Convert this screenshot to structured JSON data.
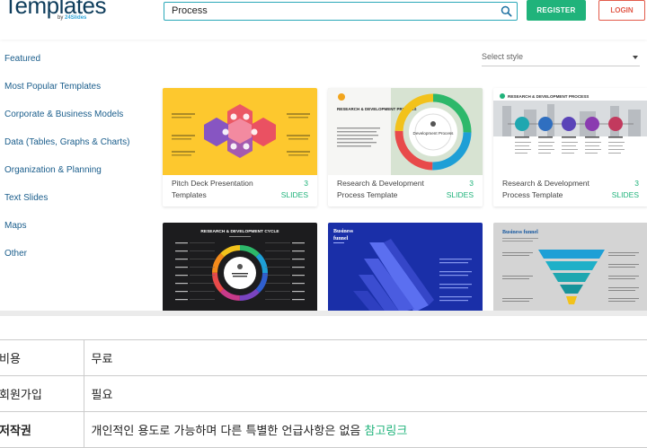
{
  "header": {
    "logo_text": "Templates",
    "logo_by": "by",
    "logo_brand": "24Slides",
    "search_value": "Process",
    "register_label": "REGISTER",
    "login_label": "LOGIN"
  },
  "sidebar": {
    "items": [
      {
        "label": "Featured"
      },
      {
        "label": "Most Popular Templates"
      },
      {
        "label": "Corporate & Business Models"
      },
      {
        "label": "Data (Tables, Graphs & Charts)"
      },
      {
        "label": "Organization & Planning"
      },
      {
        "label": "Text Slides"
      },
      {
        "label": "Maps"
      },
      {
        "label": "Other"
      }
    ]
  },
  "filter": {
    "select_style_placeholder": "Select style"
  },
  "cards": [
    {
      "title": "Pitch Deck Presentation Templates",
      "count": "3",
      "count_unit": "SLIDES"
    },
    {
      "title": "Research & Development Process Template",
      "count": "3",
      "count_unit": "SLIDES"
    },
    {
      "title": "Research & Development Process Template",
      "count": "3",
      "count_unit": "SLIDES"
    }
  ],
  "thumb_text": {
    "rd_process": "RESEARCH & DEVELOPMENT PROCESS",
    "dev_process": "Development Process",
    "rd_cycle": "RESEARCH & DEVELOPMENT CYCLE",
    "business_funnel": "Business funnel",
    "business": "Business",
    "funnel": "funnel"
  },
  "info_table": {
    "rows": [
      {
        "key": "비용",
        "value": "무료"
      },
      {
        "key": "회원가입",
        "value": "필요"
      },
      {
        "key": "저작권",
        "value": "개인적인 용도로 가능하며 다른 특별한 언급사항은 없음 ",
        "link": "참고링크"
      }
    ]
  },
  "colors": {
    "accent_green": "#20b37b",
    "login_red": "#e25a4a",
    "search_border": "#2aa8b8",
    "sidebar_link": "#1b5e8c"
  }
}
